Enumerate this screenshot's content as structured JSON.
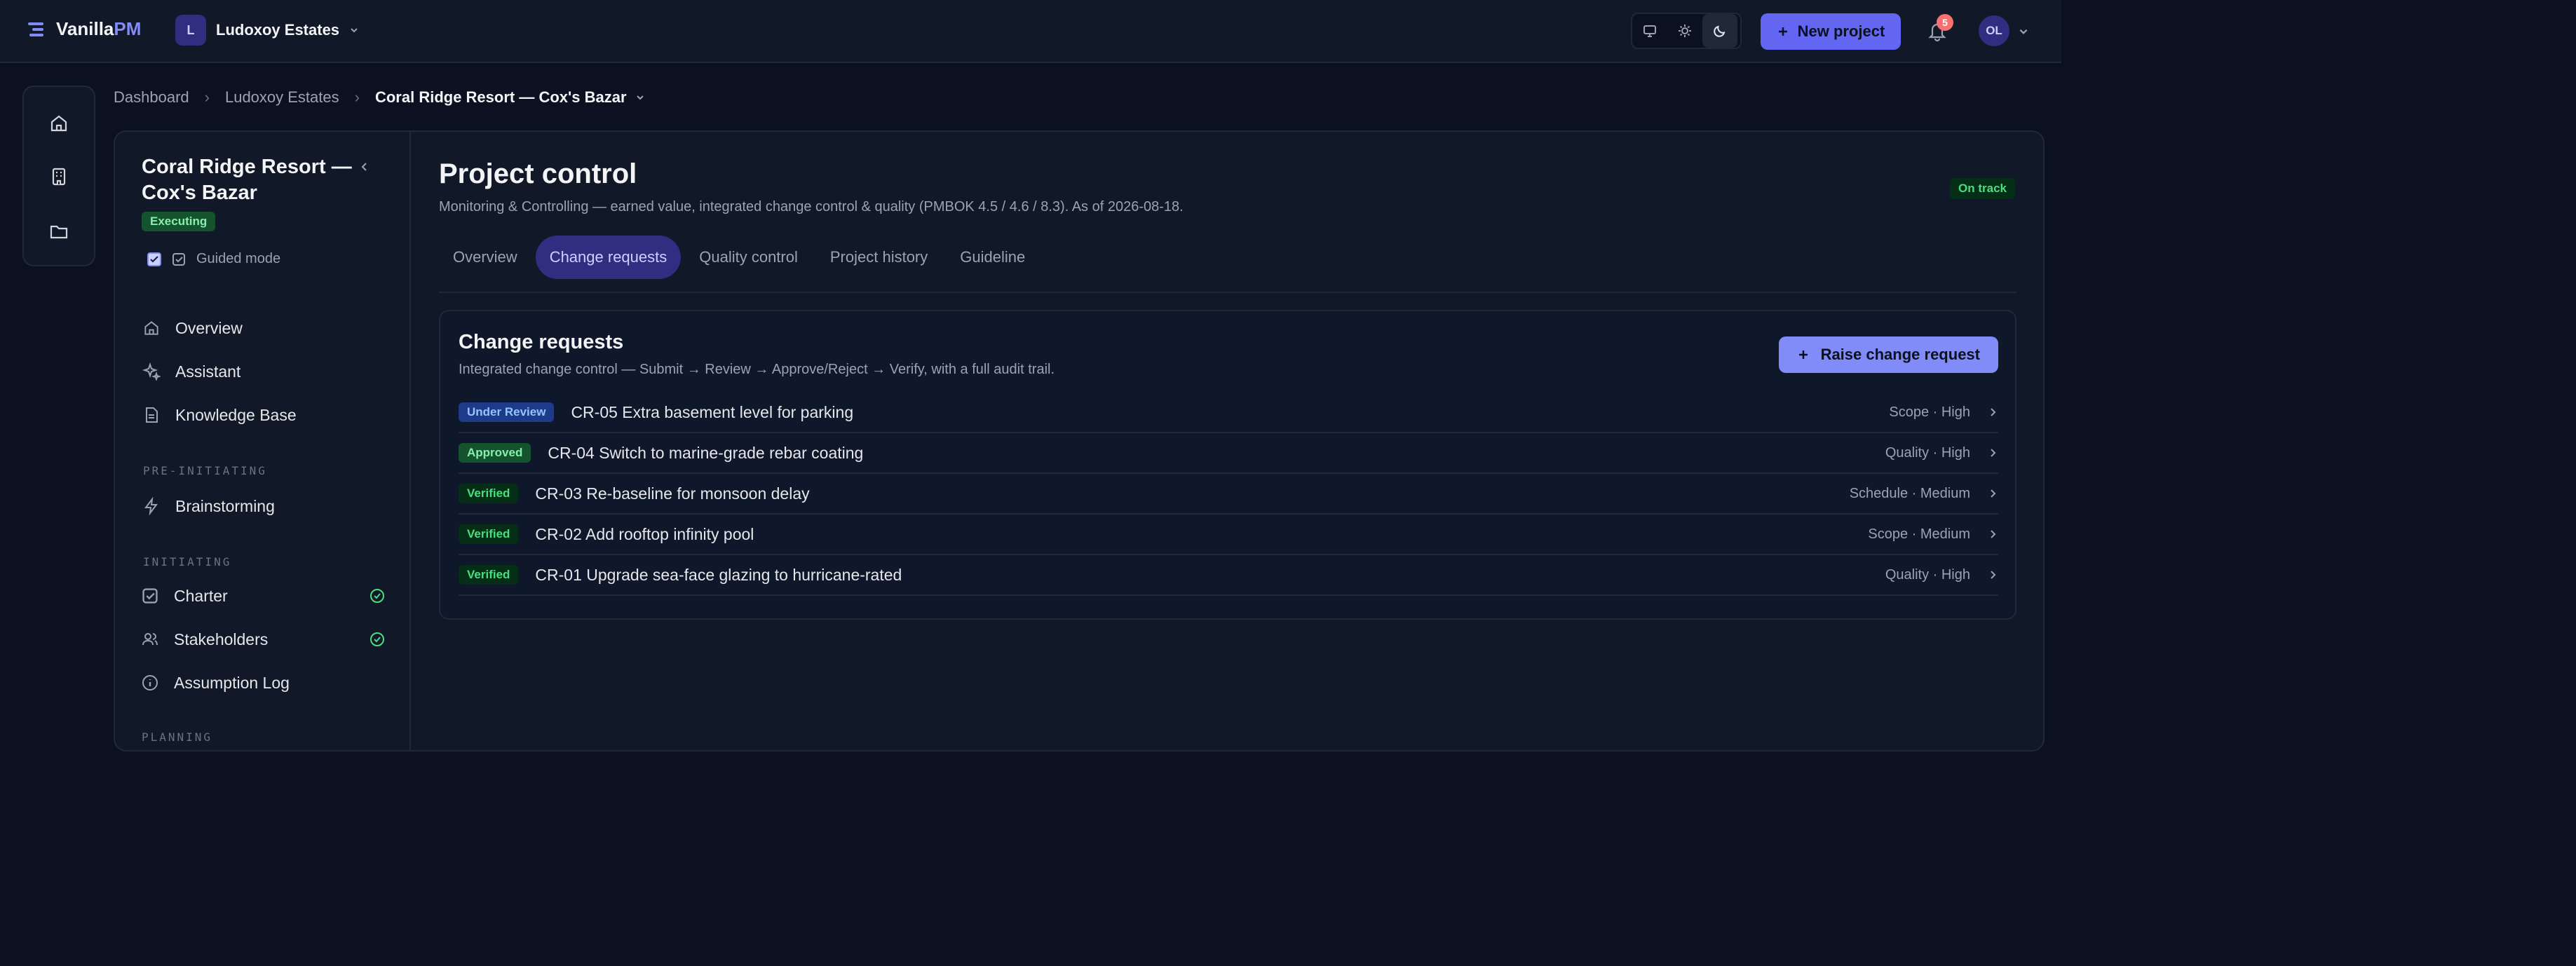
{
  "brand": {
    "name_main": "Vanilla",
    "name_accent": "PM"
  },
  "org": {
    "initial": "L",
    "name": "Ludoxoy Estates"
  },
  "topbar": {
    "new_project_label": "New project",
    "notification_count": "5",
    "user_initials": "OL",
    "theme_modes": [
      "monitor-icon",
      "sun-icon",
      "moon-icon"
    ],
    "active_theme": "moon-icon"
  },
  "breadcrumb": {
    "items": [
      "Dashboard",
      "Ludoxoy Estates"
    ],
    "current": "Coral Ridge Resort — Cox's Bazar"
  },
  "project": {
    "title": "Coral Ridge Resort — Cox's Bazar",
    "status": "Executing",
    "guided_mode_label": "Guided mode",
    "guided_mode_checked": true
  },
  "nav": {
    "top": [
      {
        "label": "Overview",
        "icon": "home-icon"
      },
      {
        "label": "Assistant",
        "icon": "sparkle-icon"
      },
      {
        "label": "Knowledge Base",
        "icon": "document-icon"
      }
    ],
    "sections": [
      {
        "label": "PRE-INITIATING",
        "items": [
          {
            "label": "Brainstorming",
            "icon": "bolt-icon",
            "done": false
          }
        ]
      },
      {
        "label": "INITIATING",
        "items": [
          {
            "label": "Charter",
            "icon": "check-square-icon",
            "done": true
          },
          {
            "label": "Stakeholders",
            "icon": "users-icon",
            "done": true
          },
          {
            "label": "Assumption Log",
            "icon": "info-icon",
            "done": false
          }
        ]
      },
      {
        "label": "PLANNING",
        "items": []
      }
    ]
  },
  "page": {
    "title": "Project control",
    "subtitle": "Monitoring & Controlling — earned value, integrated change control & quality (PMBOK 4.5 / 4.6 / 8.3). As of 2026-08-18.",
    "health": "On track",
    "tabs": [
      "Overview",
      "Change requests",
      "Quality control",
      "Project history",
      "Guideline"
    ],
    "active_tab": "Change requests"
  },
  "change_requests": {
    "title": "Change requests",
    "subtitle": "Integrated change control — Submit → Review → Approve/Reject → Verify, with a full audit trail.",
    "raise_label": "Raise change request",
    "rows": [
      {
        "status": "Under Review",
        "title": "CR-05 Extra basement level for parking",
        "meta": "Scope · High"
      },
      {
        "status": "Approved",
        "title": "CR-04 Switch to marine-grade rebar coating",
        "meta": "Quality · High"
      },
      {
        "status": "Verified",
        "title": "CR-03 Re-baseline for monsoon delay",
        "meta": "Schedule · Medium"
      },
      {
        "status": "Verified",
        "title": "CR-02 Add rooftop infinity pool",
        "meta": "Scope · Medium"
      },
      {
        "status": "Verified",
        "title": "CR-01 Upgrade sea-face glazing to hurricane-rated",
        "meta": "Quality · High"
      }
    ]
  },
  "colors": {
    "accent": "#818cf8",
    "bg": "#0b1120",
    "surface": "#111827",
    "success": "#4ade80"
  }
}
